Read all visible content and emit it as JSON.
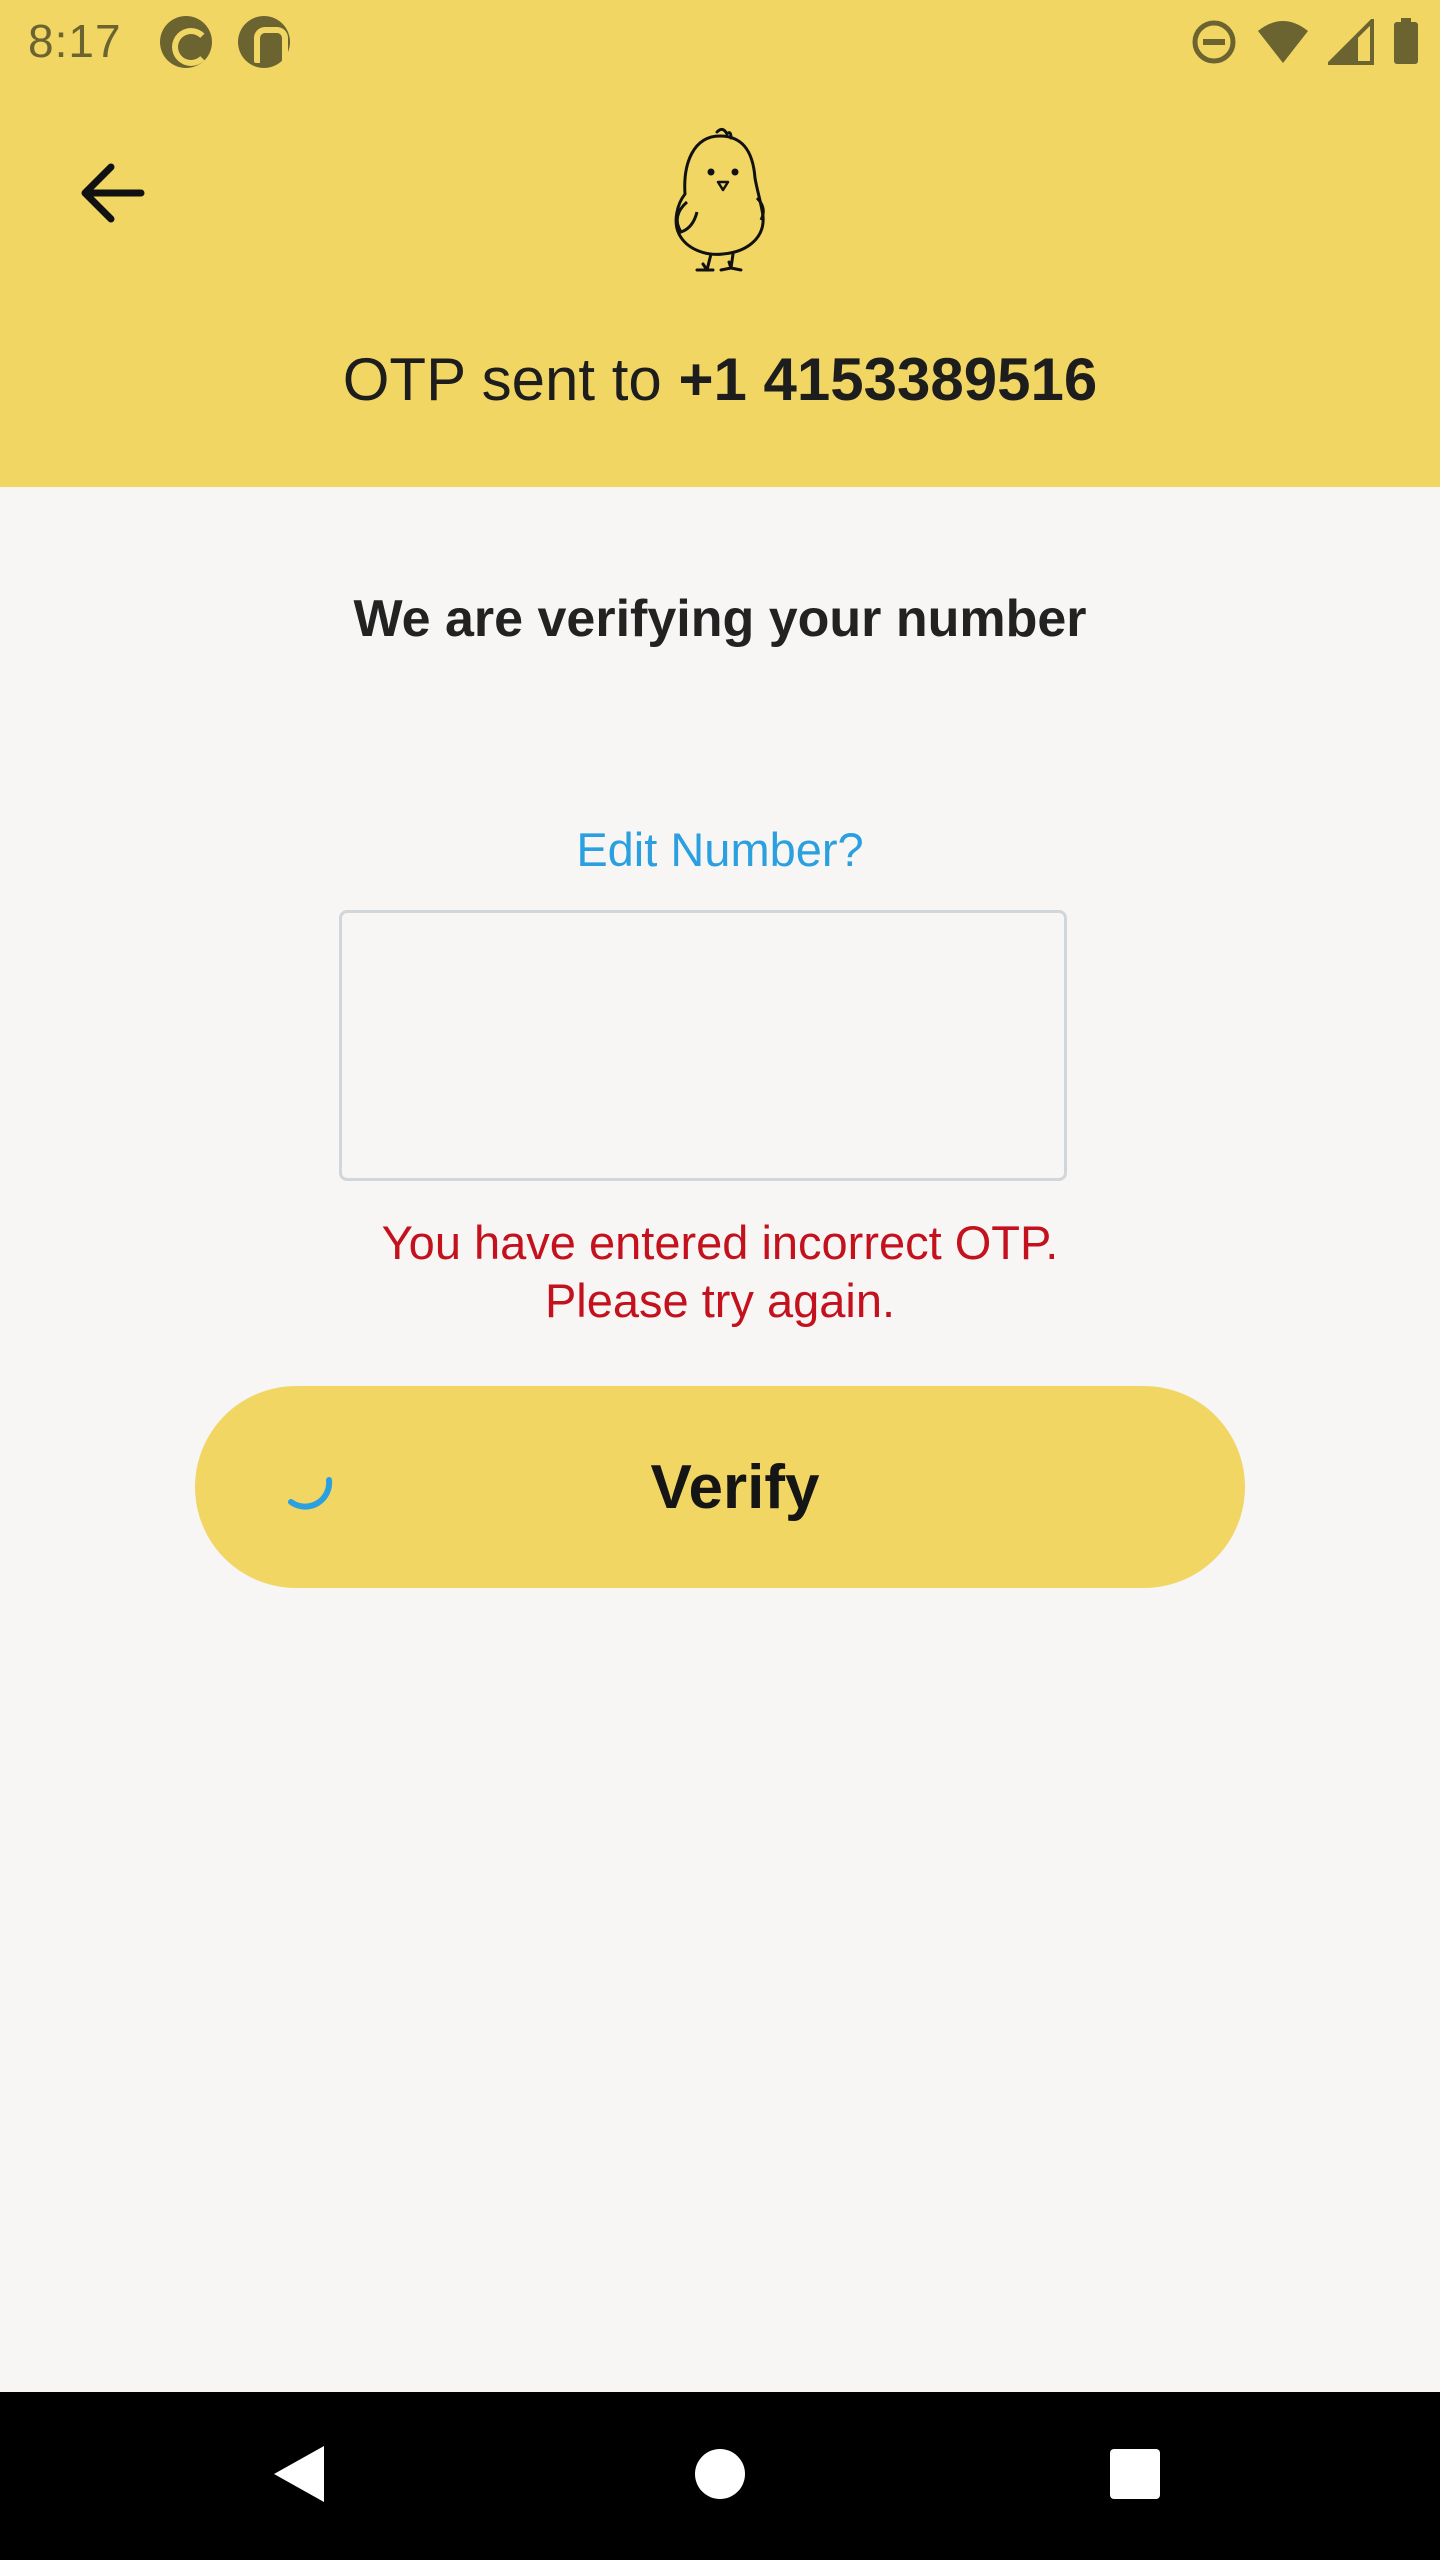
{
  "status_bar": {
    "time": "8:17",
    "icons": [
      "app-notification-icon",
      "app-notification-icon",
      "do-not-disturb-icon",
      "wifi-icon",
      "cell-signal-icon",
      "battery-icon"
    ]
  },
  "header": {
    "back_icon": "arrow-left-icon",
    "logo": "chick-logo",
    "otp_prefix": "OTP sent to ",
    "phone_number": "+1 4153389516"
  },
  "main": {
    "title": "We are verifying your number",
    "edit_number_link": "Edit Number?",
    "otp_input_value": "",
    "error_line_1": "You have entered incorrect OTP.",
    "error_line_2": "Please try again.",
    "verify_label": "Verify"
  },
  "nav_bar": {
    "icons": [
      "nav-back-icon",
      "nav-home-icon",
      "nav-recents-icon"
    ]
  },
  "colors": {
    "header_bg": "#f1d664",
    "page_bg": "#f8f6f4",
    "link": "#2aa0e0",
    "error": "#c3121e",
    "button_bg": "#f1d664",
    "spinner": "#2aa0e0"
  }
}
